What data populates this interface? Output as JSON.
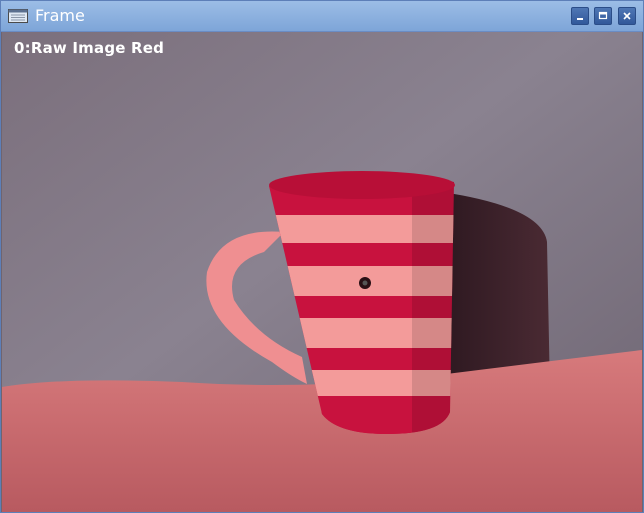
{
  "window": {
    "title": "Frame",
    "buttons": {
      "minimize": "minimize",
      "maximize": "maximize",
      "close": "close"
    },
    "titlebar_color": "#8fb2e0"
  },
  "frame": {
    "overlay_label": "0:Raw Image Red",
    "colors": {
      "wall": "#6f6470",
      "table": "#c46266",
      "mug_red": "#c8123e",
      "mug_pink": "#f39b9a",
      "shadow": "#3a1f27"
    }
  }
}
